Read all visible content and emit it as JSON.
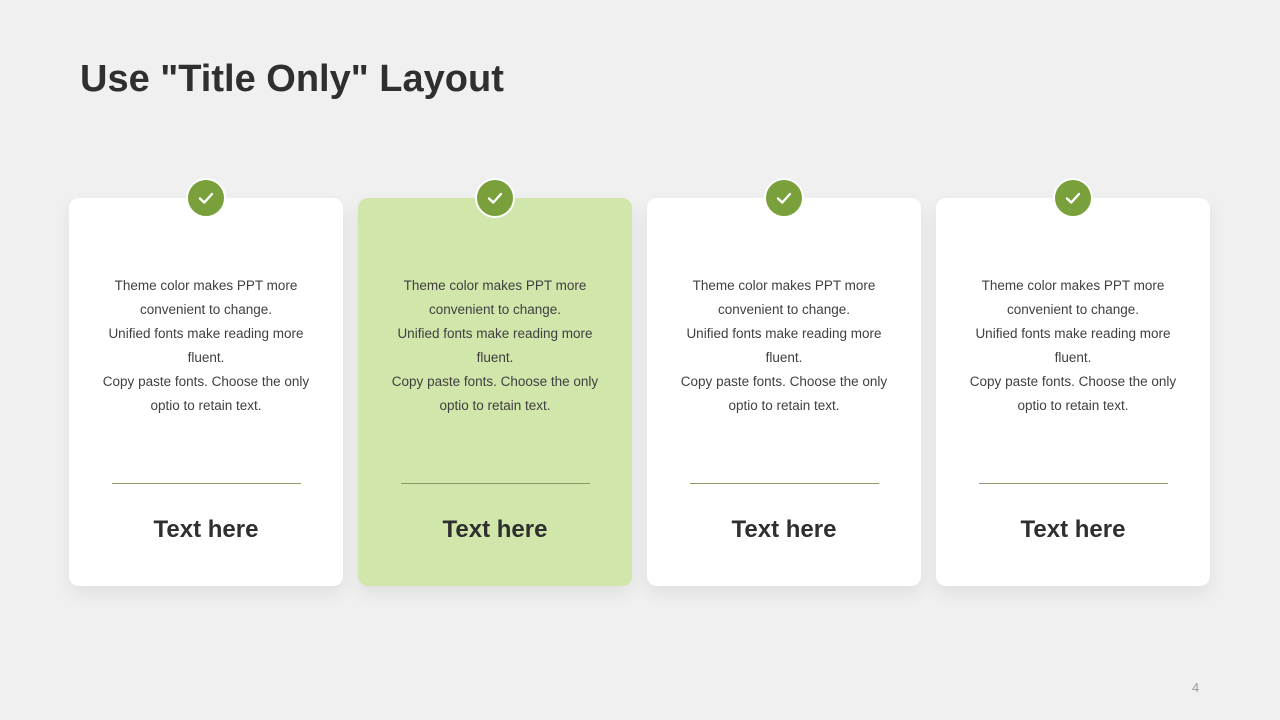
{
  "slide": {
    "title": "Use \"Title Only\" Layout",
    "page_number": "4",
    "colors": {
      "background": "#f0f0f0",
      "card": "#ffffff",
      "highlight_card": "#d1e6ab",
      "accent_green": "#79a03a",
      "text_dark": "#2f2f2f"
    },
    "cards": [
      {
        "icon": "check-icon",
        "highlighted": false,
        "lines": [
          "Theme color makes PPT more",
          "convenient  to change.",
          "Unified  fonts make reading more",
          "fluent.",
          "Copy paste fonts. Choose the only",
          "optio to retain text."
        ],
        "label": "Text here"
      },
      {
        "icon": "check-icon",
        "highlighted": true,
        "lines": [
          "Theme color makes PPT more",
          "convenient  to change.",
          "Unified  fonts make reading more",
          "fluent.",
          "Copy paste fonts. Choose the only",
          "optio to retain text."
        ],
        "label": "Text here"
      },
      {
        "icon": "check-icon",
        "highlighted": false,
        "lines": [
          "Theme color makes PPT more",
          "convenient  to change.",
          "Unified  fonts make reading more",
          "fluent.",
          "Copy paste fonts. Choose the only",
          "optio to retain text."
        ],
        "label": "Text here"
      },
      {
        "icon": "check-icon",
        "highlighted": false,
        "lines": [
          "Theme color makes PPT more",
          "convenient  to change.",
          "Unified  fonts make reading more",
          "fluent.",
          "Copy paste fonts. Choose the only",
          "optio to retain text."
        ],
        "label": "Text here"
      }
    ]
  }
}
